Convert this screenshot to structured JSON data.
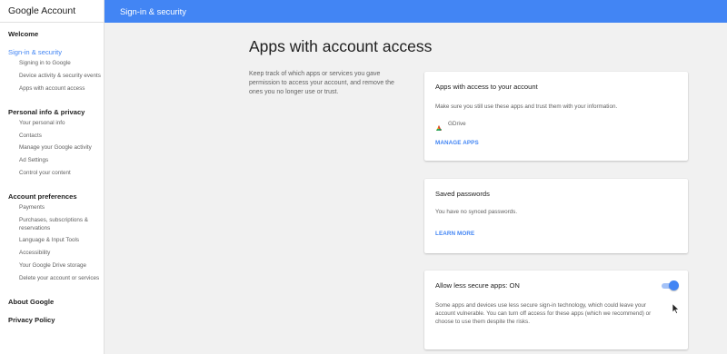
{
  "brand": "Google Account",
  "header": {
    "title": "Sign-in & security"
  },
  "sidebar": {
    "sections": [
      {
        "label": "Welcome",
        "active": false,
        "items": []
      },
      {
        "label": "Sign-in & security",
        "active": true,
        "items": [
          "Signing in to Google",
          "Device activity & security events",
          "Apps with account access"
        ]
      },
      {
        "label": "Personal info & privacy",
        "active": false,
        "items": [
          "Your personal info",
          "Contacts",
          "Manage your Google activity",
          "Ad Settings",
          "Control your content"
        ]
      },
      {
        "label": "Account preferences",
        "active": false,
        "items": [
          "Payments",
          "Purchases, subscriptions & reservations",
          "Language & Input Tools",
          "Accessibility",
          "Your Google Drive storage",
          "Delete your account or services"
        ]
      },
      {
        "label": "About Google",
        "active": false,
        "items": []
      },
      {
        "label": "Privacy Policy",
        "active": false,
        "items": []
      }
    ]
  },
  "main": {
    "title": "Apps with account access",
    "intro": "Keep track of which apps or services you gave permission to access your account, and remove the ones you no longer use or trust."
  },
  "cards": {
    "apps_access": {
      "title": "Apps with access to your account",
      "description": "Make sure you still use these apps and trust them with your information.",
      "apps": [
        {
          "name": "GDrive",
          "icon": "gdrive-icon"
        }
      ],
      "link": "MANAGE APPS"
    },
    "saved_passwords": {
      "title": "Saved passwords",
      "description": "You have no synced passwords.",
      "link": "LEARN MORE"
    },
    "less_secure": {
      "title": "Allow less secure apps: ON",
      "description": "Some apps and devices use less secure sign-in technology, which could leave your account vulnerable. You can turn off access for these apps (which we recommend) or choose to use them despite the risks.",
      "toggle_on": true
    }
  },
  "colors": {
    "accent": "#4285f4",
    "background": "#f1f1f1",
    "toggle_track": "#a4c2f7"
  }
}
